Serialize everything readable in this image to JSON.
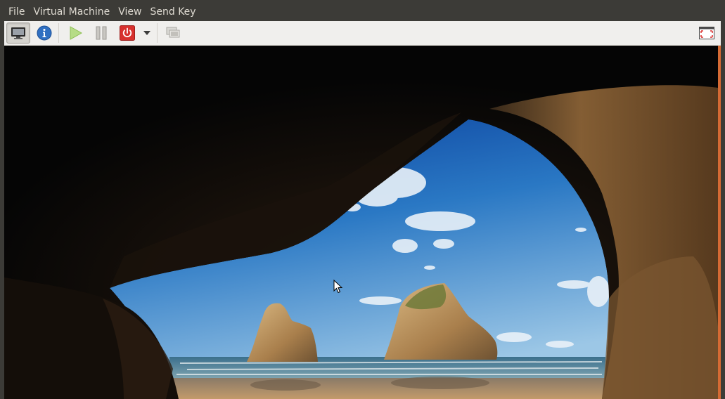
{
  "menu": {
    "file": "File",
    "virtual_machine": "Virtual Machine",
    "view": "View",
    "send_key": "Send Key"
  },
  "toolbar": {
    "buttons": [
      {
        "name": "show-console",
        "icon": "monitor-icon",
        "active": true
      },
      {
        "name": "show-details",
        "icon": "info-icon"
      },
      {
        "name": "run",
        "icon": "play-icon"
      },
      {
        "name": "pause",
        "icon": "pause-icon"
      },
      {
        "name": "shutdown",
        "icon": "power-icon"
      },
      {
        "name": "shutdown-menu",
        "icon": "chevron-down-icon"
      },
      {
        "name": "snapshots",
        "icon": "snapshots-icon"
      },
      {
        "name": "fullscreen",
        "icon": "fullscreen-icon"
      }
    ]
  },
  "colors": {
    "menubar_bg": "#3c3b37",
    "toolbar_bg": "#f0efed",
    "accent_orange": "#d56a34",
    "power_red": "#d8312e",
    "info_blue": "#2f6fc1",
    "play_green": "#9ccf5e"
  },
  "screen": {
    "content": "guest-desktop-wallpaper"
  }
}
